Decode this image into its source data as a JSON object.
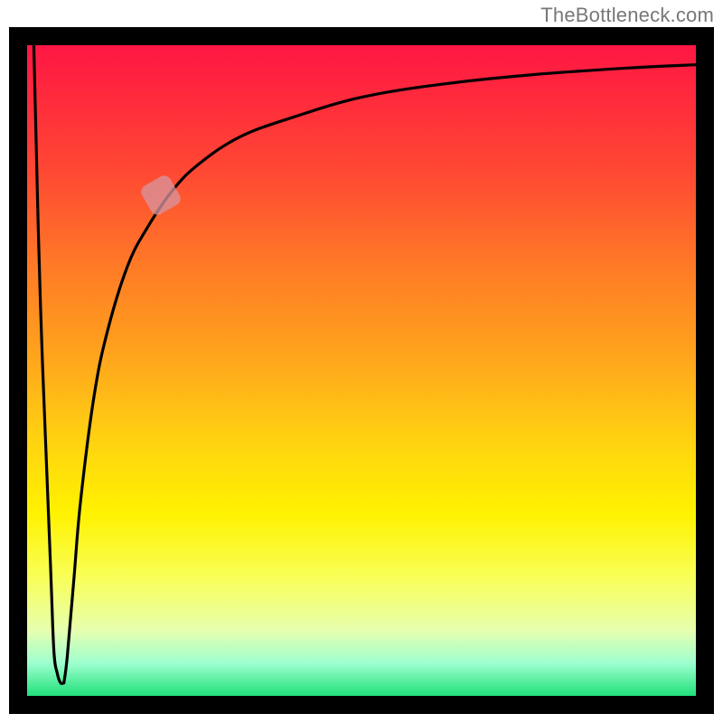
{
  "brand": {
    "watermark": "TheBottleneck.com"
  },
  "colors": {
    "curve": "#000000",
    "frame": "#000000",
    "marker": "rgba(215,150,160,0.75)",
    "gradient_top": "#ff1744",
    "gradient_mid": "#fff200",
    "gradient_bottom": "#20e07a"
  },
  "chart_data": {
    "type": "line",
    "title": "",
    "xlabel": "",
    "ylabel": "",
    "xlim": [
      0,
      100
    ],
    "ylim": [
      0,
      100
    ],
    "grid": false,
    "legend": false,
    "annotations": [
      {
        "kind": "segment-highlight",
        "x": 20,
        "y": 77,
        "note": "muted pink segment marker on curve"
      }
    ],
    "series": [
      {
        "name": "left-drop",
        "x": [
          1,
          2,
          3.5,
          4,
          4.5,
          5,
          5.5
        ],
        "values": [
          100,
          60,
          20,
          7,
          3.5,
          2,
          2
        ]
      },
      {
        "name": "main-curve",
        "x": [
          5.5,
          6,
          7,
          8,
          10,
          12,
          15,
          18,
          22,
          26,
          32,
          40,
          50,
          62,
          76,
          90,
          100
        ],
        "values": [
          2,
          6,
          18,
          30,
          46,
          56,
          66,
          72,
          78,
          82,
          86,
          89,
          92,
          94,
          95.5,
          96.5,
          97
        ]
      }
    ]
  }
}
